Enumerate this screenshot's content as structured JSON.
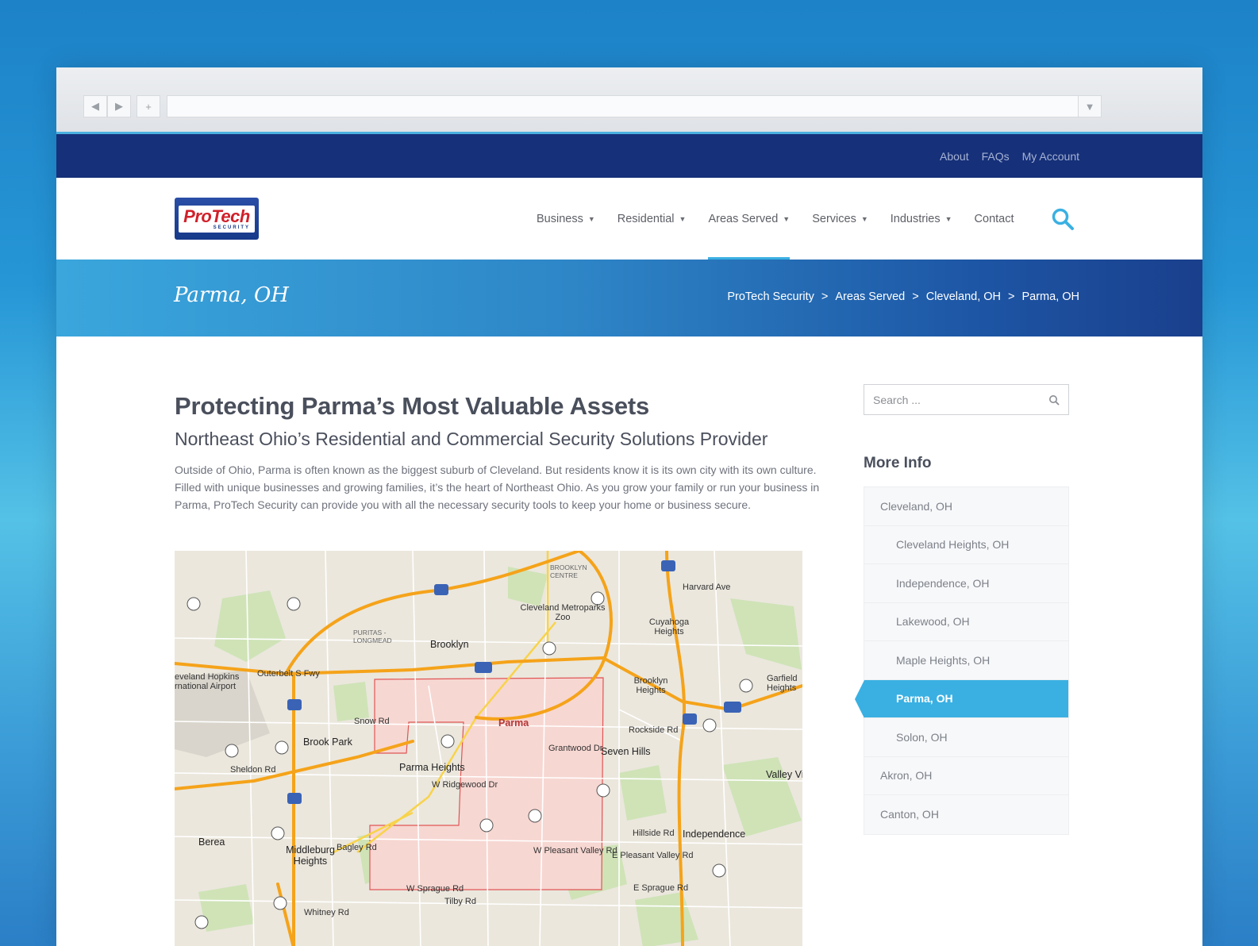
{
  "topbar": {
    "links": [
      "About",
      "FAQs",
      "My Account"
    ]
  },
  "logo": {
    "brand": "ProTech",
    "sub": "SECURITY"
  },
  "nav": {
    "items": [
      {
        "label": "Business",
        "caret": true
      },
      {
        "label": "Residential",
        "caret": true
      },
      {
        "label": "Areas Served",
        "caret": true,
        "active": true
      },
      {
        "label": "Services",
        "caret": true
      },
      {
        "label": "Industries",
        "caret": true
      },
      {
        "label": "Contact",
        "caret": false
      }
    ]
  },
  "banner": {
    "title": "Parma, OH",
    "breadcrumbs": [
      "ProTech Security",
      "Areas Served",
      "Cleveland, OH",
      "Parma, OH"
    ]
  },
  "main": {
    "heading": "Protecting Parma’s Most Valuable Assets",
    "subheading": "Northeast Ohio’s Residential and Commercial Security Solutions Provider",
    "paragraph": "Outside of Ohio, Parma is often known as the biggest suburb of Cleveland. But residents know it is its own city with its own culture. Filled with unique businesses and growing families, it’s the heart of Northeast Ohio. As you grow your family or run your business in Parma, ProTech Security can provide you with all the necessary security tools to keep your home or business secure."
  },
  "sidebar": {
    "search_placeholder": "Search ...",
    "more_info_title": "More Info",
    "items": [
      {
        "label": "Cleveland, OH",
        "sub": false
      },
      {
        "label": "Cleveland Heights, OH",
        "sub": true
      },
      {
        "label": "Independence, OH",
        "sub": true
      },
      {
        "label": "Lakewood, OH",
        "sub": true
      },
      {
        "label": "Maple Heights, OH",
        "sub": true
      },
      {
        "label": "Parma, OH",
        "sub": true,
        "active": true
      },
      {
        "label": "Solon, OH",
        "sub": true
      },
      {
        "label": "Akron, OH",
        "sub": false
      },
      {
        "label": "Canton, OH",
        "sub": false
      }
    ]
  },
  "map": {
    "labels": [
      "Parma",
      "Parma Heights",
      "Brooklyn",
      "Brook Park",
      "Seven Hills",
      "Independence",
      "Cleveland Metroparks Zoo",
      "Cuyahoga Heights",
      "Brooklyn Heights",
      "Garfield Heights",
      "Middleburg Heights",
      "Berea",
      "Valley Vi",
      "Snow Rd",
      "Grantwood Dr",
      "W Ridgewood Dr",
      "W Pleasant Valley Rd",
      "E Pleasant Valley Rd",
      "W Sprague Rd",
      "E Sprague Rd",
      "Hillside Rd",
      "Rockside Rd",
      "Outerbelt S Fwy",
      "Sheldon Rd",
      "Bagley Rd",
      "Tilby Rd",
      "Whitney Rd",
      "Harvard Ave",
      "eveland Hopkins rnational Airport",
      "PURITAS - LONGMEAD",
      "BROOKLYN CENTRE"
    ],
    "colors": {
      "highway": "#f5a31a",
      "boundary": "#e05555",
      "fill": "#f7d7d2"
    }
  }
}
